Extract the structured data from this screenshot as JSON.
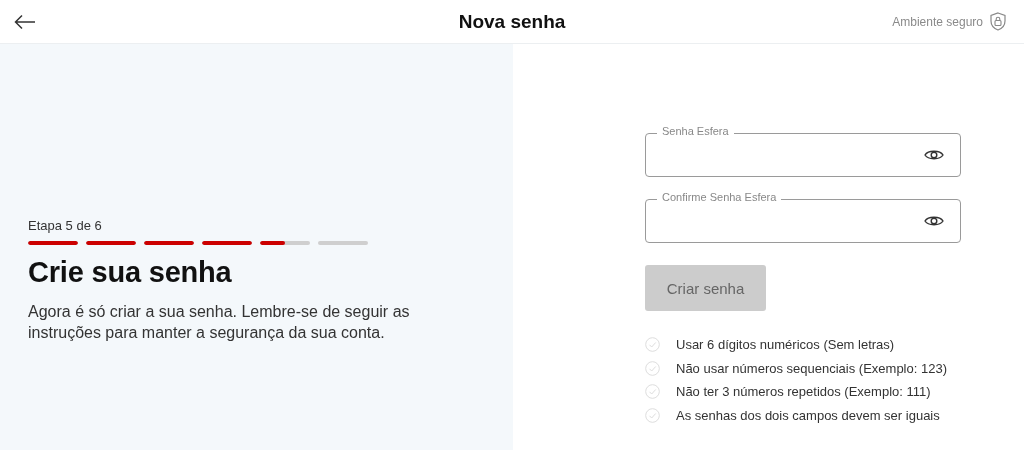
{
  "header": {
    "title": "Nova senha",
    "secure_label": "Ambiente seguro"
  },
  "step": {
    "label": "Etapa 5 de 6",
    "segments": [
      {
        "level": 1
      },
      {
        "level": 1
      },
      {
        "level": 1
      },
      {
        "level": 1
      },
      {
        "level": 0.5
      },
      {
        "level": 0
      }
    ],
    "title": "Crie sua senha",
    "description": "Agora é só criar a sua senha. Lembre-se de seguir as instruções para manter a segurança da sua conta."
  },
  "form": {
    "fields": [
      {
        "label": "Senha Esfera"
      },
      {
        "label": "Confirme Senha Esfera"
      }
    ],
    "submit": {
      "label": "Criar senha",
      "disabled": true
    },
    "rules": [
      {
        "text": "Usar 6 dígitos numéricos (Sem letras)",
        "met": false
      },
      {
        "text": "Não usar números sequenciais (Exemplo: 123)",
        "met": false
      },
      {
        "text": "Não ter 3 números repetidos (Exemplo: 111)",
        "met": false
      },
      {
        "text": "As senhas dos dois campos devem ser iguais",
        "met": false
      }
    ]
  }
}
